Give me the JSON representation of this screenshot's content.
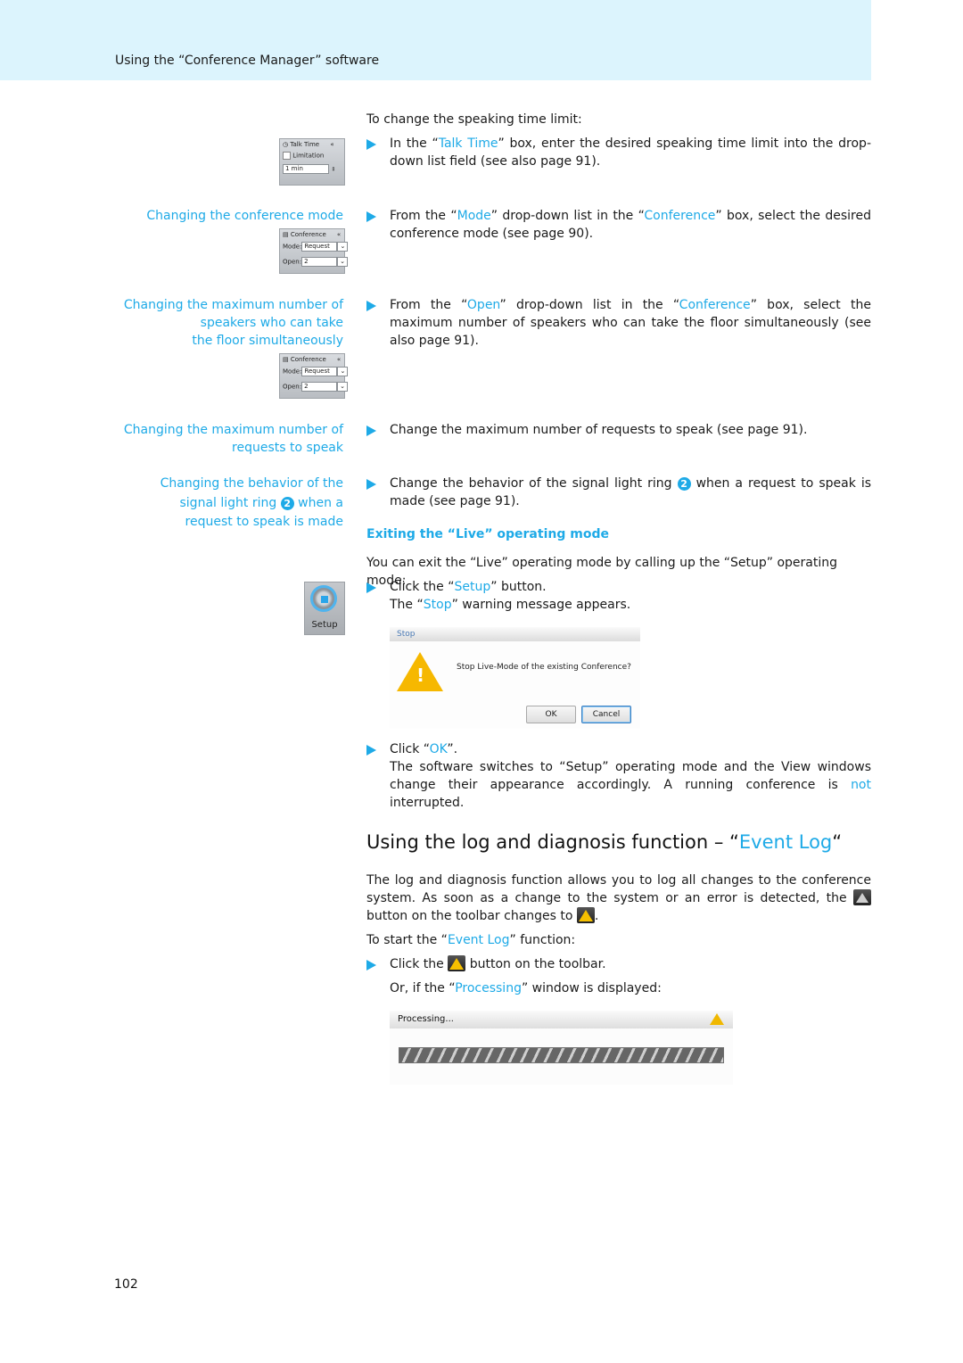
{
  "header": {
    "title": "Using the “Conference Manager” software"
  },
  "colors": {
    "accent": "#1eaae7",
    "header_band": "#dcf4fd"
  },
  "intro": "To change the speaking time limit:",
  "talk_time_widget": {
    "title": "Talk Time",
    "checkbox_label": "Limitation",
    "value": "1 min",
    "icon": "clock-icon",
    "collapse_icon": "double-chevron-left-icon"
  },
  "step_talk_time": {
    "pre": "In the “",
    "link": "Talk Time",
    "post": "” box, enter the desired speaking time limit into the drop-down list field (see also page 91)."
  },
  "side_conf_mode": "Changing the conference mode",
  "conference_widget": {
    "title": "Conference",
    "mode_label": "Mode:",
    "mode_value": "Request",
    "open_label": "Open:",
    "open_value": "2"
  },
  "step_mode": {
    "pre": "From the “",
    "link1": "Mode",
    "mid": "” drop-down list in the “",
    "link2": "Conference",
    "post": "” box, select the desired conference mode (see page 90)."
  },
  "side_max_speakers": [
    "Changing the maximum number of",
    "speakers who can take",
    "the floor simultaneously"
  ],
  "step_open": {
    "pre": "From the “",
    "link1": "Open",
    "mid": "” drop-down list in the “",
    "link2": "Conference",
    "post": "” box, select the maximum number of speakers who can take the floor simultaneously (see also page 91)."
  },
  "side_max_requests": [
    "Changing the maximum number of",
    "requests to speak"
  ],
  "step_requests": "Change the maximum number of requests to speak (see page 91).",
  "side_signal": {
    "line1": "Changing the behavior of the",
    "line2a": "signal light ring",
    "num": "2",
    "line2b": "when a",
    "line3": "request to speak is made"
  },
  "step_signal": {
    "pre": "Change the behavior of the signal light ring",
    "num": "2",
    "post": "when a request to speak is made (see page 91)."
  },
  "section_exit": {
    "heading": "Exiting the “Live” operating mode",
    "intro": "You can exit the “Live” operating mode by calling up the “Setup” operating mode:",
    "step1_pre": "Click the “",
    "step1_link": "Setup",
    "step1_post": "” button.",
    "result_pre": "The “",
    "result_link": "Stop",
    "result_post": "” warning message appears.",
    "setup_button_label": "Setup",
    "dialog": {
      "title": "Stop",
      "message": "Stop Live-Mode of the existing Conference?",
      "ok": "OK",
      "cancel": "Cancel"
    },
    "step2_pre": "Click “",
    "step2_link": "OK",
    "step2_post": "”.",
    "final_pre": "The software switches to “Setup” operating mode and the View windows change their appearance accordingly. A running conference is ",
    "final_link": "not",
    "final_post": " interrupted."
  },
  "section_log": {
    "heading_pre": "Using the log and diagnosis function – “",
    "heading_link": "Event Log",
    "heading_post": "“",
    "para_a": "The log and diagnosis function allows you to log all changes to the conference system. As soon as a change to the system or an error is detected, the",
    "para_b": "button on the toolbar changes to",
    "para_c": ".",
    "start_pre": "To start the “",
    "start_link": "Event Log",
    "start_post": "” function:",
    "step_pre": "Click the",
    "step_post": "button on the toolbar.",
    "or_pre": "Or, if the “",
    "or_link": "Processing",
    "or_post": "” window is displayed:",
    "processing_title": "Processing..."
  },
  "page_number": "102"
}
